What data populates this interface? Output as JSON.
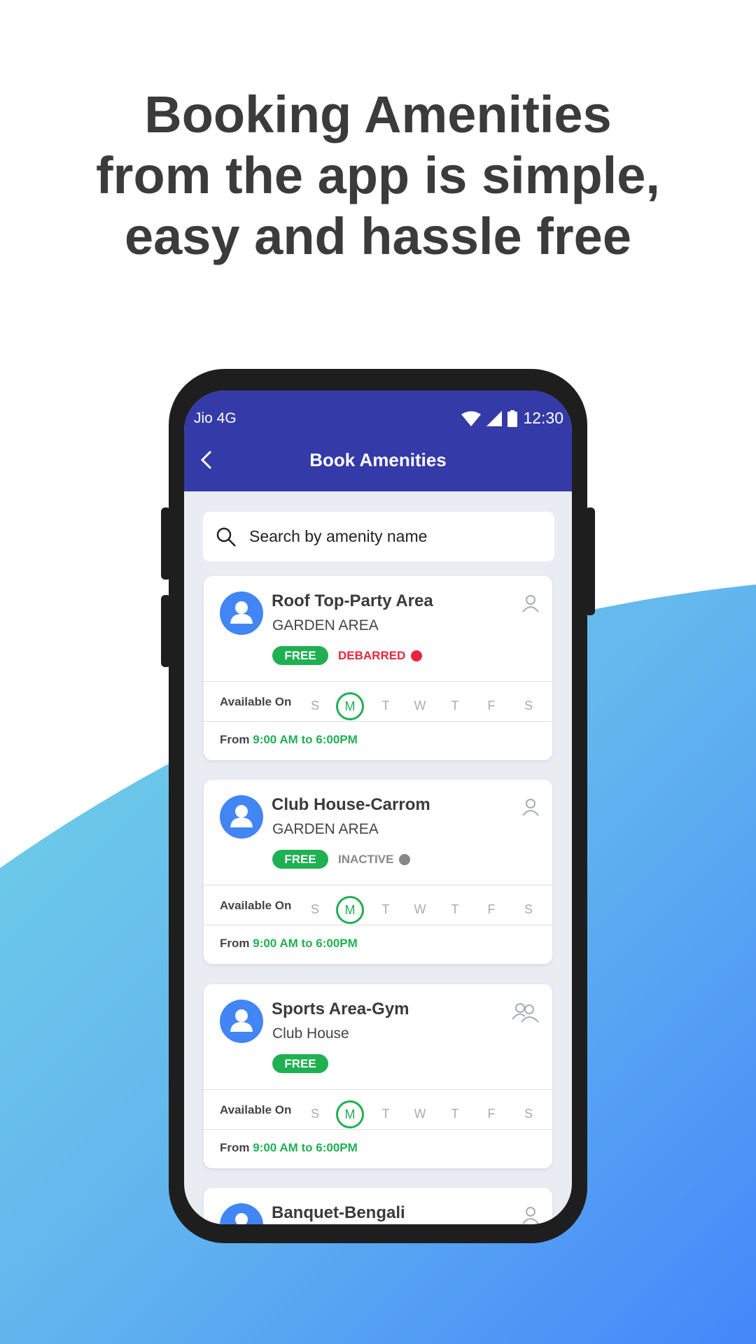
{
  "headline": [
    "Booking Amenities",
    "from the app is simple,",
    "easy and hassle free"
  ],
  "colors": {
    "appbar": "#343ba8",
    "free": "#1fb051",
    "debarred": "#e8253f",
    "inactive": "#888888",
    "avatar": "#4285f4"
  },
  "status_bar": {
    "carrier": "Jio 4G",
    "time": "12:30",
    "icons": [
      "wifi-icon",
      "signal-icon",
      "battery-icon"
    ]
  },
  "app": {
    "title": "Book Amenities",
    "back_icon": "chevron-left-icon"
  },
  "search": {
    "placeholder": "Search by amenity name",
    "value": ""
  },
  "available_label": "Available On",
  "from_label": "From",
  "days": [
    "S",
    "M",
    "T",
    "W",
    "T",
    "F",
    "S"
  ],
  "cards": [
    {
      "title": "Roof Top-Party Area",
      "subtitle": "GARDEN AREA",
      "badge": "FREE",
      "status": "DEBARRED",
      "status_color": "#e8253f",
      "selected_day": 1,
      "hours": "9:00 AM to 6:00PM",
      "icon": "user-icon"
    },
    {
      "title": "Club House-Carrom",
      "subtitle": "GARDEN AREA",
      "badge": "FREE",
      "status": "INACTIVE",
      "status_color": "#888888",
      "selected_day": 1,
      "hours": "9:00 AM to 6:00PM",
      "icon": "user-icon"
    },
    {
      "title": "Sports Area-Gym",
      "subtitle": "Club House",
      "badge": "FREE",
      "status": "",
      "selected_day": 1,
      "hours": "9:00 AM to 6:00PM",
      "icon": "users-icon"
    },
    {
      "title": "Banquet-Bengali",
      "icon": "user-icon"
    }
  ]
}
